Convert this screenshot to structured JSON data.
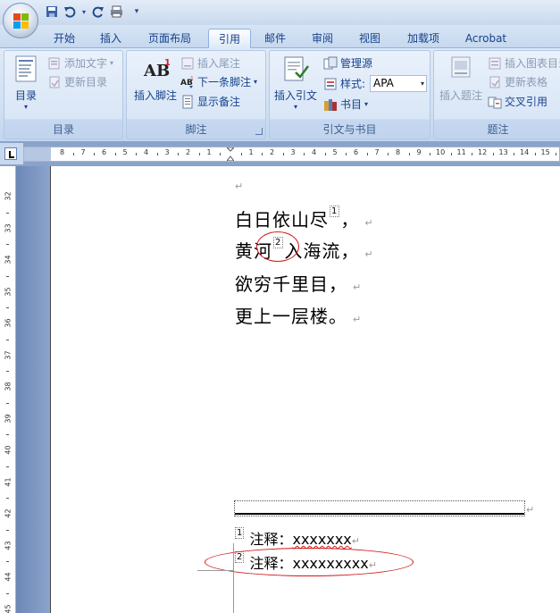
{
  "tabs": [
    {
      "label": "开始"
    },
    {
      "label": "插入"
    },
    {
      "label": "页面布局"
    },
    {
      "label": "引用"
    },
    {
      "label": "邮件"
    },
    {
      "label": "审阅"
    },
    {
      "label": "视图"
    },
    {
      "label": "加载项"
    },
    {
      "label": "Acrobat"
    }
  ],
  "ribbon": {
    "toc": {
      "label": "目录",
      "big": "目录",
      "add_text": "添加文字",
      "update": "更新目录"
    },
    "footnotes": {
      "label": "脚注",
      "insert": "插入脚注",
      "insert_endnote": "插入尾注",
      "next": "下一条脚注",
      "show": "显示备注"
    },
    "citations": {
      "label": "引文与书目",
      "insert": "插入引文",
      "manage": "管理源",
      "style_label": "样式:",
      "style_value": "APA",
      "bibliography": "书目"
    },
    "captions": {
      "label": "题注",
      "insert": "插入题注",
      "insert_table": "插入图表目录",
      "update_table": "更新表格",
      "cross_ref": "交叉引用"
    }
  },
  "ruler": {
    "h_left": [
      "8",
      "7",
      "6",
      "5",
      "4",
      "3",
      "2",
      "1"
    ],
    "h_right": [
      "1",
      "2",
      "3",
      "4",
      "5",
      "6",
      "7",
      "8",
      "9",
      "10",
      "11",
      "12",
      "13",
      "14",
      "15"
    ],
    "v": [
      "32",
      "33",
      "34",
      "35",
      "36",
      "37",
      "38",
      "39",
      "40",
      "41",
      "42",
      "43",
      "44",
      "45"
    ]
  },
  "document": {
    "empty_mark": "↵",
    "lines": [
      {
        "before": "白日依山尽",
        "ref": "1",
        "after": "，"
      },
      {
        "before": "黄河",
        "ref": "2",
        "after": "入海流，"
      },
      {
        "before": "欲穷千里目，",
        "ref": "",
        "after": ""
      },
      {
        "before": "更上一层楼。",
        "ref": "",
        "after": ""
      }
    ],
    "para_mark": "↵",
    "footnotes": [
      {
        "num": "1",
        "label": "注释：",
        "text": "xxxxxxx"
      },
      {
        "num": "2",
        "label": "注释：",
        "text": "xxxxxxxxx"
      }
    ]
  },
  "colors": {
    "annotation": "#d01818",
    "ribbon": "#dfe9f6",
    "tab_text": "#15428b"
  }
}
